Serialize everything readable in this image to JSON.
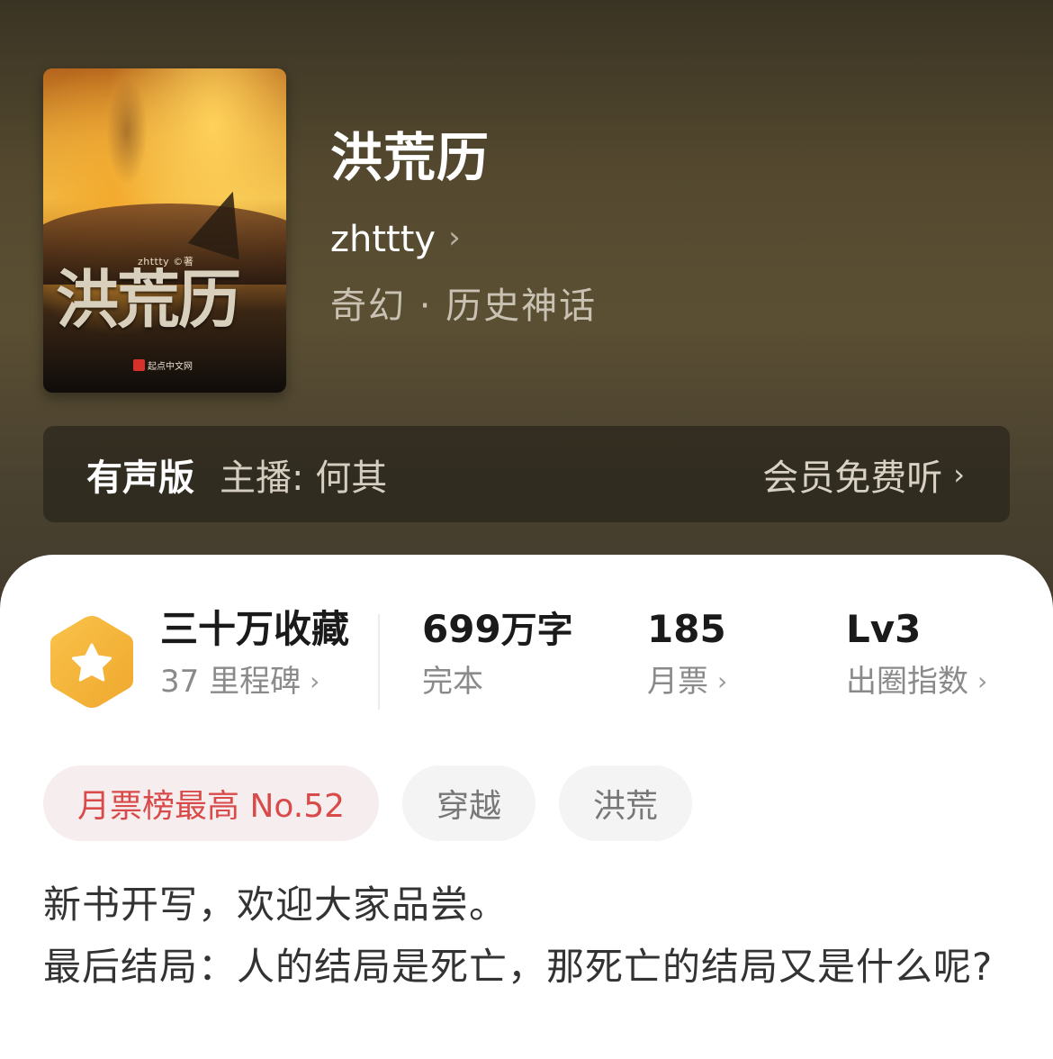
{
  "book": {
    "cover": {
      "author_text": "zhttty ©著",
      "title_text": "洪荒历",
      "publisher_text": "起点中文网"
    },
    "title": "洪荒历",
    "author": "zhttty",
    "genre": "奇幻 · 历史神话"
  },
  "audio": {
    "label": "有声版",
    "host": "主播: 何其",
    "cta": "会员免费听"
  },
  "stats": {
    "favorites": {
      "value": "三十万收藏",
      "sub": "37 里程碑"
    },
    "words": {
      "value": "699",
      "unit": "万字",
      "sub": "完本"
    },
    "tickets": {
      "value": "185",
      "sub": "月票"
    },
    "level": {
      "value": "Lv3",
      "sub": "出圈指数"
    }
  },
  "tags": [
    "月票榜最高 No.52",
    "穿越",
    "洪荒"
  ],
  "description": [
    "新书开写，欢迎大家品尝。",
    "最后结局：人的结局是死亡，那死亡的结局又是什么呢?"
  ],
  "colors": {
    "rank_tag_text": "#d94a4a",
    "badge_orange": "#f5b437"
  },
  "icons": {
    "chevron": "chevron-right-icon",
    "badge": "star-hexagon-icon"
  }
}
